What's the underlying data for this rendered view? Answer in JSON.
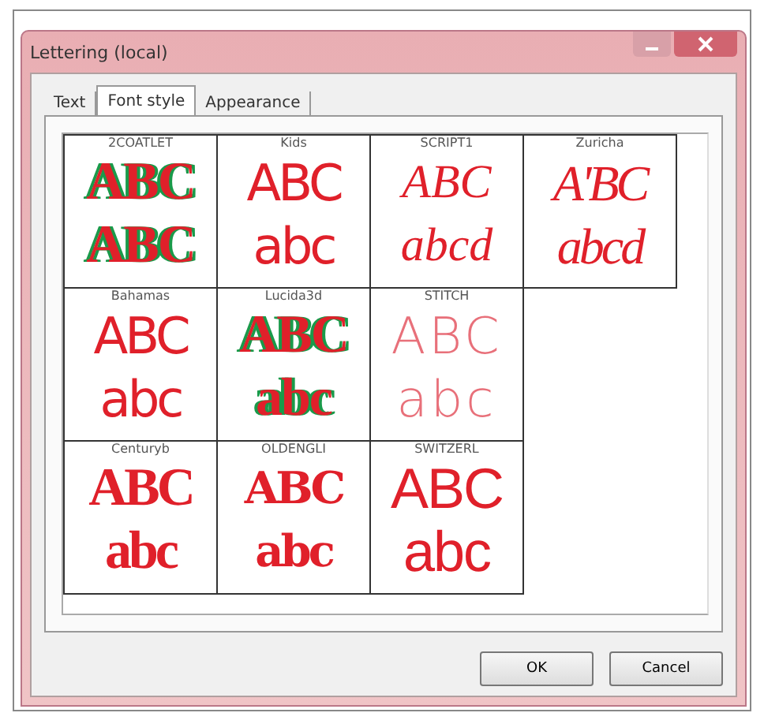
{
  "window": {
    "title": "Lettering (local)"
  },
  "tabs": [
    {
      "label": "Text",
      "selected": false
    },
    {
      "label": "Font style",
      "selected": true
    },
    {
      "label": "Appearance",
      "selected": false
    }
  ],
  "font_rows": [
    [
      {
        "name": "2COATLET",
        "upper": "ABC",
        "lower": "ABC",
        "kind": "two-tone",
        "color": "#e0202a"
      },
      {
        "name": "Kids",
        "upper": "ABC",
        "lower": "abc",
        "kind": "rounded",
        "color": "#e0202a"
      },
      {
        "name": "SCRIPT1",
        "upper": "ABC",
        "lower": "abcd",
        "kind": "script",
        "color": "#e0202a"
      },
      {
        "name": "Zuricha",
        "upper": "A'BC",
        "lower": "abcd",
        "kind": "italic-serif",
        "color": "#e0202a"
      }
    ],
    [
      {
        "name": "Bahamas",
        "upper": "ABC",
        "lower": "abc",
        "kind": "rounded",
        "color": "#e0202a"
      },
      {
        "name": "Lucida3d",
        "upper": "ABC",
        "lower": "abc",
        "kind": "two-tone",
        "color": "#e0202a"
      },
      {
        "name": "STITCH",
        "upper": "ABC",
        "lower": "abc",
        "kind": "stitch",
        "color": "#e8707a"
      }
    ],
    [
      {
        "name": "Centuryb",
        "upper": "ABC",
        "lower": "abc",
        "kind": "serif",
        "color": "#e0202a"
      },
      {
        "name": "OLDENGLI",
        "upper": "ABC",
        "lower": "abc",
        "kind": "gothic",
        "color": "#e0202a"
      },
      {
        "name": "SWITZERL",
        "upper": "ABC",
        "lower": "abc",
        "kind": "sans",
        "color": "#e0202a"
      }
    ]
  ],
  "buttons": [
    {
      "label": "OK"
    },
    {
      "label": "Cancel"
    }
  ]
}
